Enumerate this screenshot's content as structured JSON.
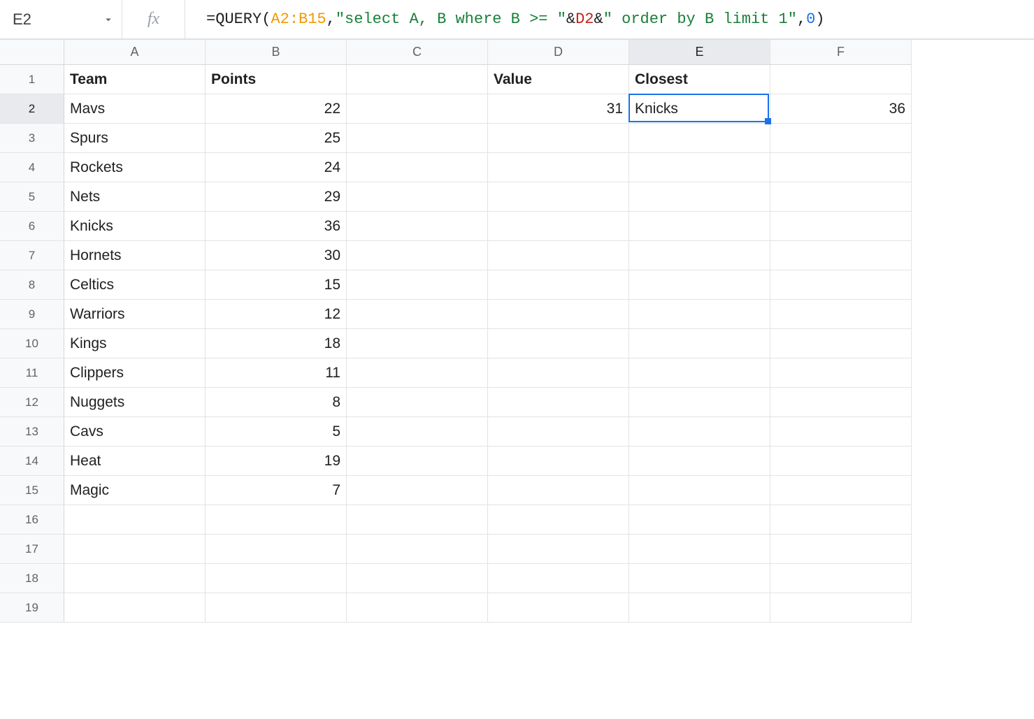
{
  "nameBox": "E2",
  "fxLabel": "fx",
  "formula": {
    "prefix": "=QUERY(",
    "range": "A2:B15",
    "comma1": ",",
    "str1": "\"select A, B where B >= \"",
    "amp1": "&",
    "ref": "D2",
    "amp2": "&",
    "str2": "\" order by B limit 1\"",
    "comma2": ",",
    "num": "0",
    "suffix": ")"
  },
  "columns": [
    "A",
    "B",
    "C",
    "D",
    "E",
    "F"
  ],
  "numRows": 19,
  "activeCell": {
    "row": 2,
    "col": 5
  },
  "header": {
    "A": "Team",
    "B": "Points",
    "D": "Value",
    "E": "Closest"
  },
  "teams": [
    "Mavs",
    "Spurs",
    "Rockets",
    "Nets",
    "Knicks",
    "Hornets",
    "Celtics",
    "Warriors",
    "Kings",
    "Clippers",
    "Nuggets",
    "Cavs",
    "Heat",
    "Magic"
  ],
  "points": [
    22,
    25,
    24,
    29,
    36,
    30,
    15,
    12,
    18,
    11,
    8,
    5,
    19,
    7
  ],
  "D2": 31,
  "E2": "Knicks",
  "F2": 36
}
